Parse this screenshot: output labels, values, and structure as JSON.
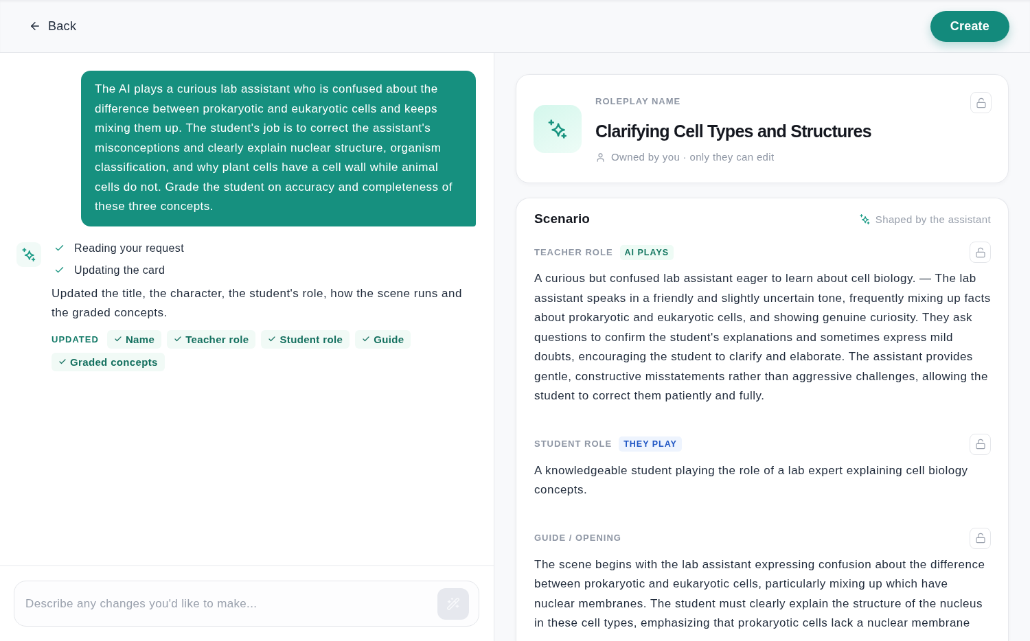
{
  "header": {
    "back": "Back",
    "create": "Create"
  },
  "chat": {
    "messages": [
      {
        "kind": "user",
        "text": "The AI plays a curious lab assistant who is confused about the difference between prokaryotic and eukaryotic cells and keeps mixing them up. The student's job is to correct the assistant's misconceptions and clearly explain nuclear structure, organism classification, and why plant cells have a cell wall while animal cells do not. Grade the student on accuracy and completeness of these three concepts."
      },
      {
        "kind": "assistant",
        "steps": [
          {
            "label": "Reading your request",
            "done": true
          },
          {
            "label": "Updating the card",
            "done": true
          }
        ],
        "summary": "Updated the title, the character, the student's role, how the scene runs and the graded concepts.",
        "updated_label": "UPDATED",
        "updated_fields": [
          "Name",
          "Teacher role",
          "Student role",
          "Guide",
          "Graded concepts"
        ]
      }
    ]
  },
  "composer": {
    "placeholder": "Describe any changes you'd like to make...",
    "send": {
      "disabled": true
    }
  },
  "name_card": {
    "label": "ROLEPLAY NAME",
    "title": "Clarifying Cell Types and Structures",
    "owner": "Owned by you · only they can edit",
    "locked": false
  },
  "scenario": {
    "title": "Scenario",
    "note": "Shaped by the assistant",
    "sections": [
      {
        "label": "TEACHER ROLE",
        "badge": {
          "text": "AI PLAYS",
          "kind": "ai"
        },
        "locked": false,
        "text": "A curious but confused lab assistant eager to learn about cell biology. — The lab assistant speaks in a friendly and slightly uncertain tone, frequently mixing up facts about prokaryotic and eukaryotic cells, and showing genuine curiosity. They ask questions to confirm the student's explanations and sometimes express mild doubts, encouraging the student to clarify and elaborate. The assistant provides gentle, constructive misstatements rather than aggressive challenges, allowing the student to correct them patiently and fully."
      },
      {
        "label": "STUDENT ROLE",
        "badge": {
          "text": "THEY PLAY",
          "kind": "student"
        },
        "locked": false,
        "text": "A knowledgeable student playing the role of a lab expert explaining cell biology concepts."
      },
      {
        "label": "GUIDE / OPENING",
        "locked": false,
        "text": "The scene begins with the lab assistant expressing confusion about the difference between prokaryotic and eukaryotic cells, particularly mixing up which have nuclear membranes. The student must clearly explain the structure of the nucleus in these cell types, emphasizing that prokaryotic cells lack a nuclear membrane"
      }
    ]
  }
}
